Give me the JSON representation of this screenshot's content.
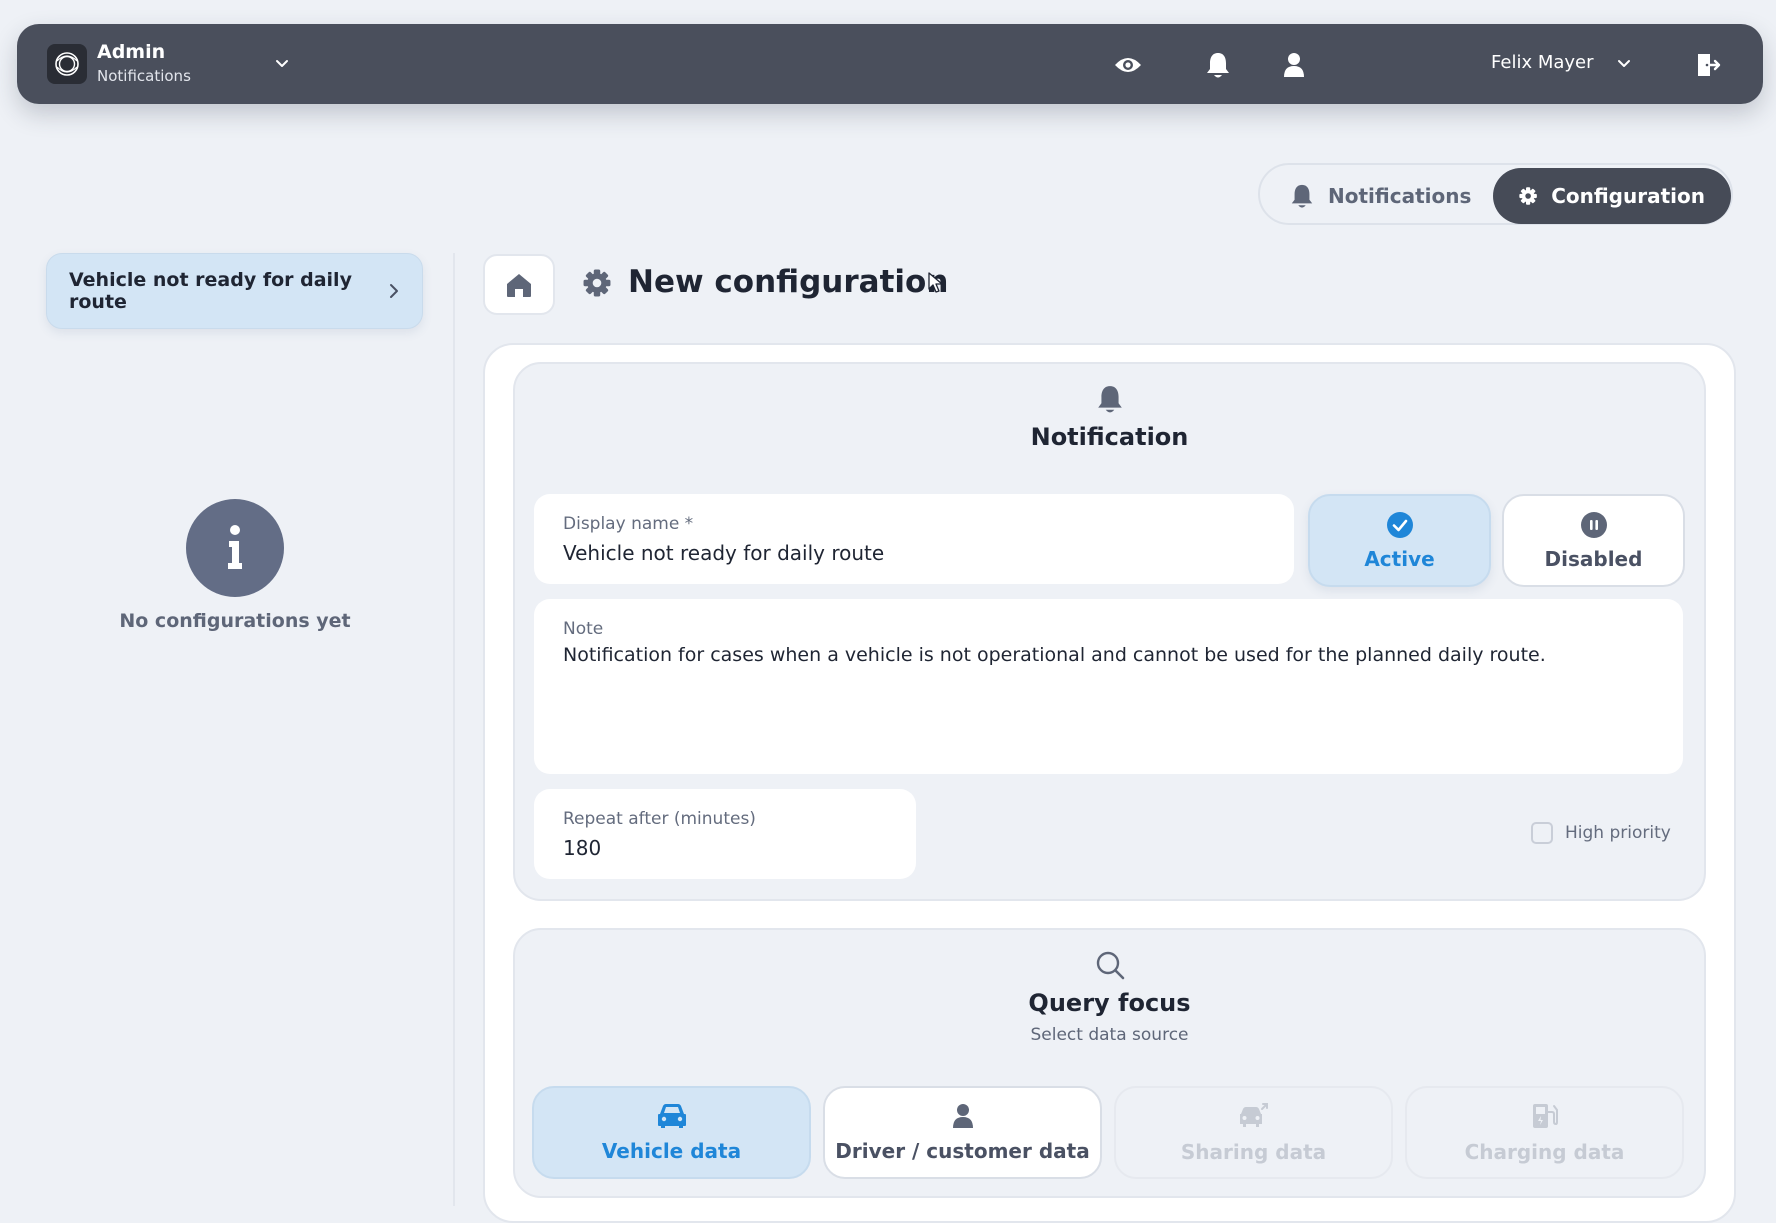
{
  "topbar": {
    "app_title": "Admin",
    "app_subtitle": "Notifications",
    "user_name": "Felix Mayer",
    "icons": [
      "app-logo-icon",
      "chevron-down-icon",
      "eye-icon",
      "bell-icon",
      "user-icon",
      "chevron-down-icon",
      "logout-icon"
    ]
  },
  "mode_toggle": {
    "notifications_label": "Notifications",
    "configuration_label": "Configuration",
    "selected": "Configuration"
  },
  "sidebar": {
    "items": [
      {
        "label": "Vehicle not ready for daily route"
      }
    ],
    "empty_text": "No configurations yet"
  },
  "page": {
    "title": "New configuration"
  },
  "notification_section": {
    "title": "Notification",
    "display_name_label": "Display name *",
    "display_name_value": "Vehicle not ready for daily route",
    "status_active_label": "Active",
    "status_disabled_label": "Disabled",
    "status_selected": "Active",
    "note_label": "Note",
    "note_value": "Notification for cases when a vehicle is not operational and cannot be used for the planned daily route.",
    "repeat_label": "Repeat after (minutes)",
    "repeat_value": "180",
    "high_priority_label": "High priority",
    "high_priority_checked": false
  },
  "query_section": {
    "title": "Query focus",
    "subtitle": "Select data source",
    "sources": [
      {
        "label": "Vehicle data",
        "icon": "car-icon",
        "state": "selected"
      },
      {
        "label": "Driver / customer data",
        "icon": "user-icon",
        "state": "available"
      },
      {
        "label": "Sharing data",
        "icon": "car-share-icon",
        "state": "disabled"
      },
      {
        "label": "Charging data",
        "icon": "charging-station-icon",
        "state": "disabled"
      }
    ]
  },
  "colors": {
    "accent": "#1f86d8",
    "topbar_bg": "#4a4f5c",
    "selected_bg": "#d3e5f5",
    "page_bg": "#eef1f6"
  }
}
